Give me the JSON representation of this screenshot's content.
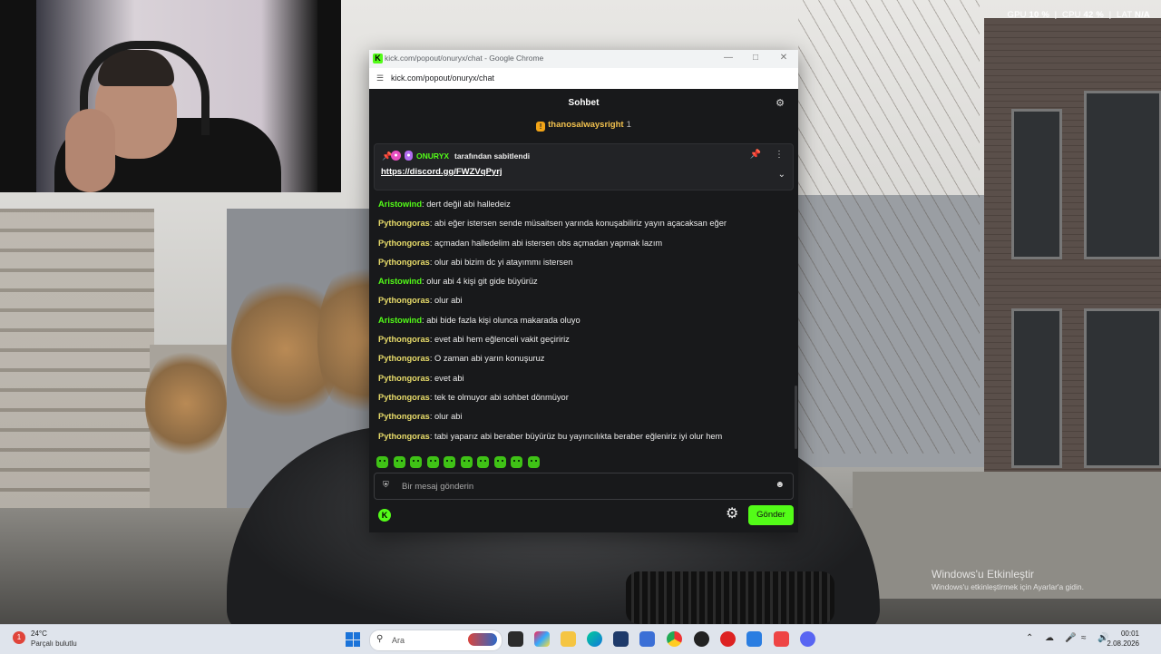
{
  "window": {
    "title": "kick.com/popout/onuryx/chat - Google Chrome",
    "logo": "K",
    "url": "kick.com/popout/onuryx/chat"
  },
  "chat": {
    "title": "Sohbet",
    "gifter": {
      "name": "thanosalwaysright",
      "count": "1"
    },
    "pinned": {
      "author": "ONURYX",
      "by_text": "tarafından sabitlendi",
      "link": "https://discord.gg/FWZVqPyrj"
    },
    "messages": [
      {
        "user": "Aristowind",
        "color": "#53fc18",
        "text": "dert değil abi halledeiz"
      },
      {
        "user": "Pythongoras",
        "color": "#e8dc6a",
        "text": "abi eğer istersen sende müsaitsen yarında konuşabiliriz yayın açacaksan eğer"
      },
      {
        "user": "Pythongoras",
        "color": "#e8dc6a",
        "text": "açmadan halledelim abi istersen obs açmadan yapmak lazım"
      },
      {
        "user": "Pythongoras",
        "color": "#e8dc6a",
        "text": "olur abi bizim dc yi atayımmı istersen"
      },
      {
        "user": "Aristowind",
        "color": "#53fc18",
        "text": "olur abi 4 kişi git gide büyürüz"
      },
      {
        "user": "Pythongoras",
        "color": "#e8dc6a",
        "text": "olur abi"
      },
      {
        "user": "Aristowind",
        "color": "#53fc18",
        "text": "abi bide fazla kişi olunca makarada oluyo"
      },
      {
        "user": "Pythongoras",
        "color": "#e8dc6a",
        "text": "evet abi hem eğlenceli vakit geçiririz"
      },
      {
        "user": "Pythongoras",
        "color": "#e8dc6a",
        "text": "O zaman abi yarın konuşuruz"
      },
      {
        "user": "Pythongoras",
        "color": "#e8dc6a",
        "text": "evet abi"
      },
      {
        "user": "Pythongoras",
        "color": "#e8dc6a",
        "text": "tek te olmuyor abi sohbet dönmüyor"
      },
      {
        "user": "Pythongoras",
        "color": "#e8dc6a",
        "text": "olur abi"
      },
      {
        "user": "Pythongoras",
        "color": "#e8dc6a",
        "text": "tabi yaparız abi beraber büyürüz bu yayıncılıkta beraber eğleniriz iyi olur hem"
      }
    ],
    "emote_count": 10,
    "input_placeholder": "Bir mesaj gönderin",
    "send_label": "Gönder",
    "footer_logo": "K"
  },
  "overlay": {
    "gpu_label": "GPU",
    "gpu_value": "10 %",
    "cpu_label": "CPU",
    "cpu_value": "42 %",
    "lat_label": "LAT",
    "lat_value": "N/A"
  },
  "activation": {
    "title": "Windows'u Etkinleştir",
    "subtitle": "Windows'u etkinleştirmek için Ayarlar'a gidin."
  },
  "taskbar": {
    "weather_temp": "24°C",
    "weather_desc": "Parçalı bulutlu",
    "weather_badge": "1",
    "search_placeholder": "Ara",
    "time": "00:01",
    "date": "2.08.2026",
    "colors": {
      "start": "#1a73d9",
      "kick": "#53fc18"
    }
  }
}
